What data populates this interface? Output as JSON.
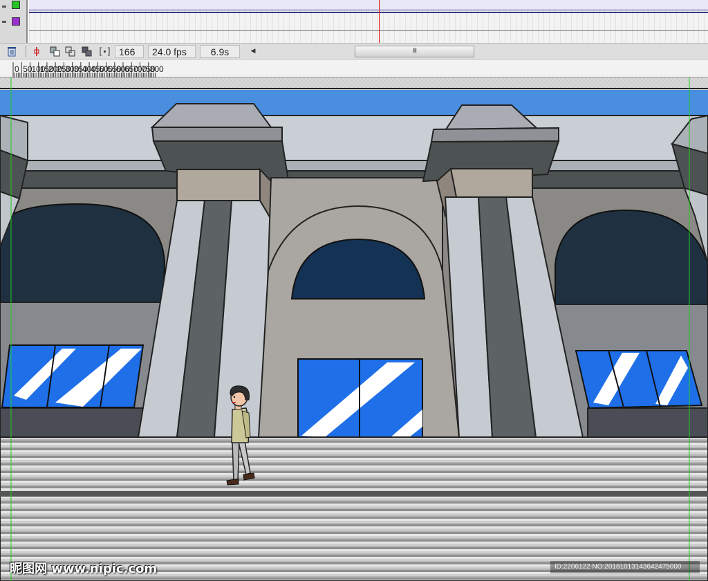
{
  "timeline": {
    "layers": [
      {
        "swatch_color": "#27c427",
        "icon": "layer-color-swatch"
      },
      {
        "swatch_color": "#9b2fd0",
        "icon": "layer-color-swatch"
      }
    ],
    "playhead_color": "#dd1111"
  },
  "statusbar": {
    "trash_icon": "trash-icon",
    "icons": [
      "center-frame-icon",
      "onion-skin-icon",
      "onion-skin-outlines-icon",
      "edit-multiple-frames-icon",
      "modify-markers-icon"
    ],
    "current_frame": "166",
    "frame_rate": "24.0 fps",
    "elapsed_time": "6.9s",
    "scroll_left_icon": "scroll-left-arrow-icon",
    "scroll_grip": "III"
  },
  "ruler": {
    "labels": [
      "0",
      "50",
      "100",
      "150",
      "200",
      "250",
      "300",
      "350",
      "400",
      "450",
      "500",
      "550",
      "600",
      "650",
      "700",
      "750",
      "800"
    ]
  },
  "stage": {
    "guide_color": "#22cc22",
    "sky_color": "#4a8ee0",
    "glass_color": "#1f6fe8",
    "character": "walking-man"
  },
  "watermark": {
    "logo_text": "昵图网 www.nipic.com",
    "id_text": "ID:2206122 NO:20181013143642475000"
  }
}
